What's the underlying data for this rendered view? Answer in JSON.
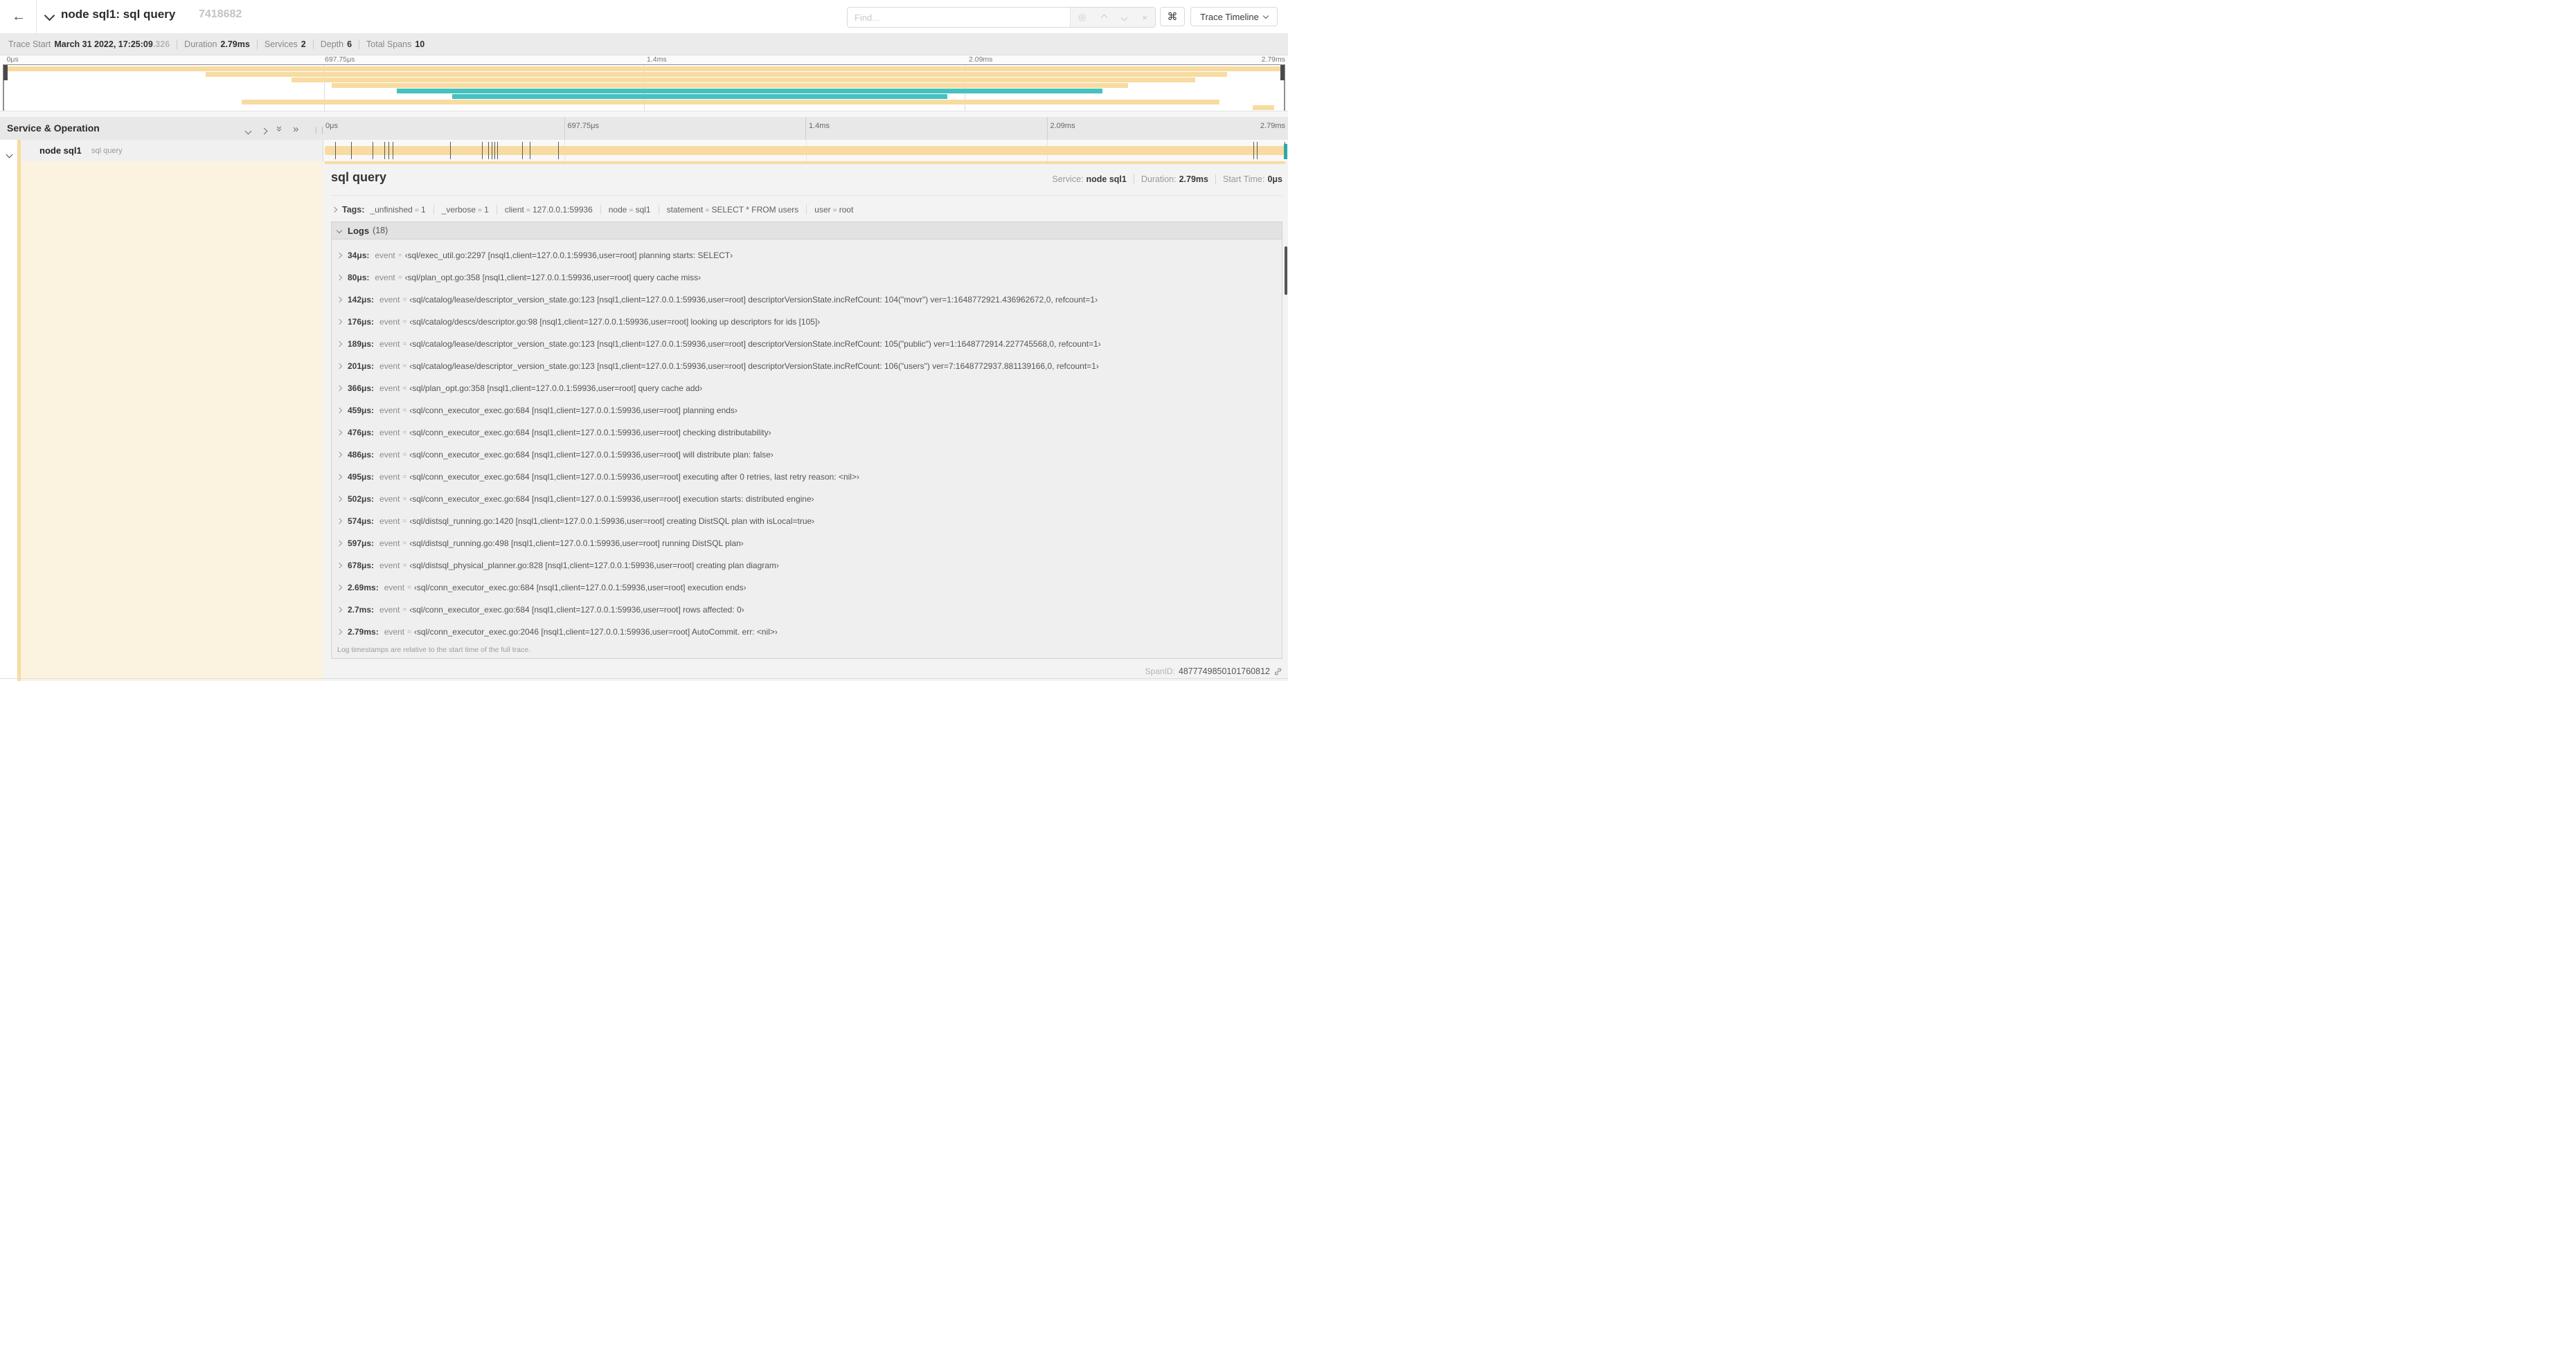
{
  "header": {
    "back": "←",
    "title": "node sql1: sql query",
    "trace_id_short": "7418682",
    "find_placeholder": "Find...",
    "keyboard_button": "⌘",
    "view_dropdown": "Trace Timeline"
  },
  "trace_info": [
    {
      "label": "Trace Start",
      "value": "March 31 2022, 17:25:09",
      "suffix": ".326"
    },
    {
      "label": "Duration",
      "value": "2.79ms"
    },
    {
      "label": "Services",
      "value": "2"
    },
    {
      "label": "Depth",
      "value": "6"
    },
    {
      "label": "Total Spans",
      "value": "10"
    }
  ],
  "ruler_ticks": [
    "0μs",
    "697.75μs",
    "1.4ms",
    "2.09ms",
    "2.79ms"
  ],
  "colors": {
    "beige": "#F8DBA1",
    "teal": "#45C1C0",
    "cream": "#FBF3E0"
  },
  "minimap": {
    "rows": [
      {
        "start": 0.0,
        "end": 1.0,
        "color": "beige"
      },
      {
        "start": 0.158,
        "end": 0.955,
        "color": "beige"
      },
      {
        "start": 0.225,
        "end": 0.93,
        "color": "beige"
      },
      {
        "start": 0.256,
        "end": 0.878,
        "color": "beige"
      },
      {
        "start": 0.307,
        "end": 0.858,
        "color": "teal"
      },
      {
        "start": 0.35,
        "end": 0.737,
        "color": "teal"
      },
      {
        "start": 0.186,
        "end": 0.949,
        "color": "beige"
      },
      {
        "start": 0.975,
        "end": 0.992,
        "color": "beige"
      }
    ]
  },
  "sidebar": {
    "header": "Service & Operation",
    "row": {
      "service": "node sql1",
      "operation": "sql query"
    }
  },
  "timeline": {
    "duration_us": 2790,
    "log_marks_us": [
      34,
      80,
      142,
      176,
      189,
      201,
      366,
      459,
      476,
      486,
      495,
      502,
      574,
      597,
      678,
      2690,
      2700,
      2780
    ]
  },
  "detail": {
    "title": "sql query",
    "overview": [
      {
        "label": "Service:",
        "value": "node sql1"
      },
      {
        "label": "Duration:",
        "value": "2.79ms"
      },
      {
        "label": "Start Time:",
        "value": "0μs"
      }
    ],
    "tags_label": "Tags:",
    "tags": [
      {
        "key": "_unfinished",
        "value": "1"
      },
      {
        "key": "_verbose",
        "value": "1"
      },
      {
        "key": "client",
        "value": "127.0.0.1:59936"
      },
      {
        "key": "node",
        "value": "sql1"
      },
      {
        "key": "statement",
        "value": "SELECT * FROM users"
      },
      {
        "key": "user",
        "value": "root"
      }
    ],
    "logs_label": "Logs",
    "logs_count": "(18)",
    "log_field": "event",
    "logs": [
      {
        "t": "34μs:",
        "msg": "‹sql/exec_util.go:2297 [nsql1,client=127.0.0.1:59936,user=root] planning starts: SELECT›"
      },
      {
        "t": "80μs:",
        "msg": "‹sql/plan_opt.go:358 [nsql1,client=127.0.0.1:59936,user=root] query cache miss›"
      },
      {
        "t": "142μs:",
        "msg": "‹sql/catalog/lease/descriptor_version_state.go:123 [nsql1,client=127.0.0.1:59936,user=root] descriptorVersionState.incRefCount: 104(\"movr\") ver=1:1648772921.436962672,0, refcount=1›"
      },
      {
        "t": "176μs:",
        "msg": "‹sql/catalog/descs/descriptor.go:98 [nsql1,client=127.0.0.1:59936,user=root] looking up descriptors for ids [105]›"
      },
      {
        "t": "189μs:",
        "msg": "‹sql/catalog/lease/descriptor_version_state.go:123 [nsql1,client=127.0.0.1:59936,user=root] descriptorVersionState.incRefCount: 105(\"public\") ver=1:1648772914.227745568,0, refcount=1›"
      },
      {
        "t": "201μs:",
        "msg": "‹sql/catalog/lease/descriptor_version_state.go:123 [nsql1,client=127.0.0.1:59936,user=root] descriptorVersionState.incRefCount: 106(\"users\") ver=7:1648772937.881139166,0, refcount=1›"
      },
      {
        "t": "366μs:",
        "msg": "‹sql/plan_opt.go:358 [nsql1,client=127.0.0.1:59936,user=root] query cache add›"
      },
      {
        "t": "459μs:",
        "msg": "‹sql/conn_executor_exec.go:684 [nsql1,client=127.0.0.1:59936,user=root] planning ends›"
      },
      {
        "t": "476μs:",
        "msg": "‹sql/conn_executor_exec.go:684 [nsql1,client=127.0.0.1:59936,user=root] checking distributability›"
      },
      {
        "t": "486μs:",
        "msg": "‹sql/conn_executor_exec.go:684 [nsql1,client=127.0.0.1:59936,user=root] will distribute plan: false›"
      },
      {
        "t": "495μs:",
        "msg": "‹sql/conn_executor_exec.go:684 [nsql1,client=127.0.0.1:59936,user=root] executing after 0 retries, last retry reason: <nil>›"
      },
      {
        "t": "502μs:",
        "msg": "‹sql/conn_executor_exec.go:684 [nsql1,client=127.0.0.1:59936,user=root] execution starts: distributed engine›"
      },
      {
        "t": "574μs:",
        "msg": "‹sql/distsql_running.go:1420 [nsql1,client=127.0.0.1:59936,user=root] creating DistSQL plan with isLocal=true›"
      },
      {
        "t": "597μs:",
        "msg": "‹sql/distsql_running.go:498 [nsql1,client=127.0.0.1:59936,user=root] running DistSQL plan›"
      },
      {
        "t": "678μs:",
        "msg": "‹sql/distsql_physical_planner.go:828 [nsql1,client=127.0.0.1:59936,user=root] creating plan diagram›"
      },
      {
        "t": "2.69ms:",
        "msg": "‹sql/conn_executor_exec.go:684 [nsql1,client=127.0.0.1:59936,user=root] execution ends›"
      },
      {
        "t": "2.7ms:",
        "msg": "‹sql/conn_executor_exec.go:684 [nsql1,client=127.0.0.1:59936,user=root] rows affected: 0›"
      },
      {
        "t": "2.79ms:",
        "msg": "‹sql/conn_executor_exec.go:2046 [nsql1,client=127.0.0.1:59936,user=root] AutoCommit. err: <nil>›"
      }
    ],
    "logs_footer": "Log timestamps are relative to the start time of the full trace.",
    "span_id_label": "SpanID:",
    "span_id": "4877749850101760812"
  }
}
